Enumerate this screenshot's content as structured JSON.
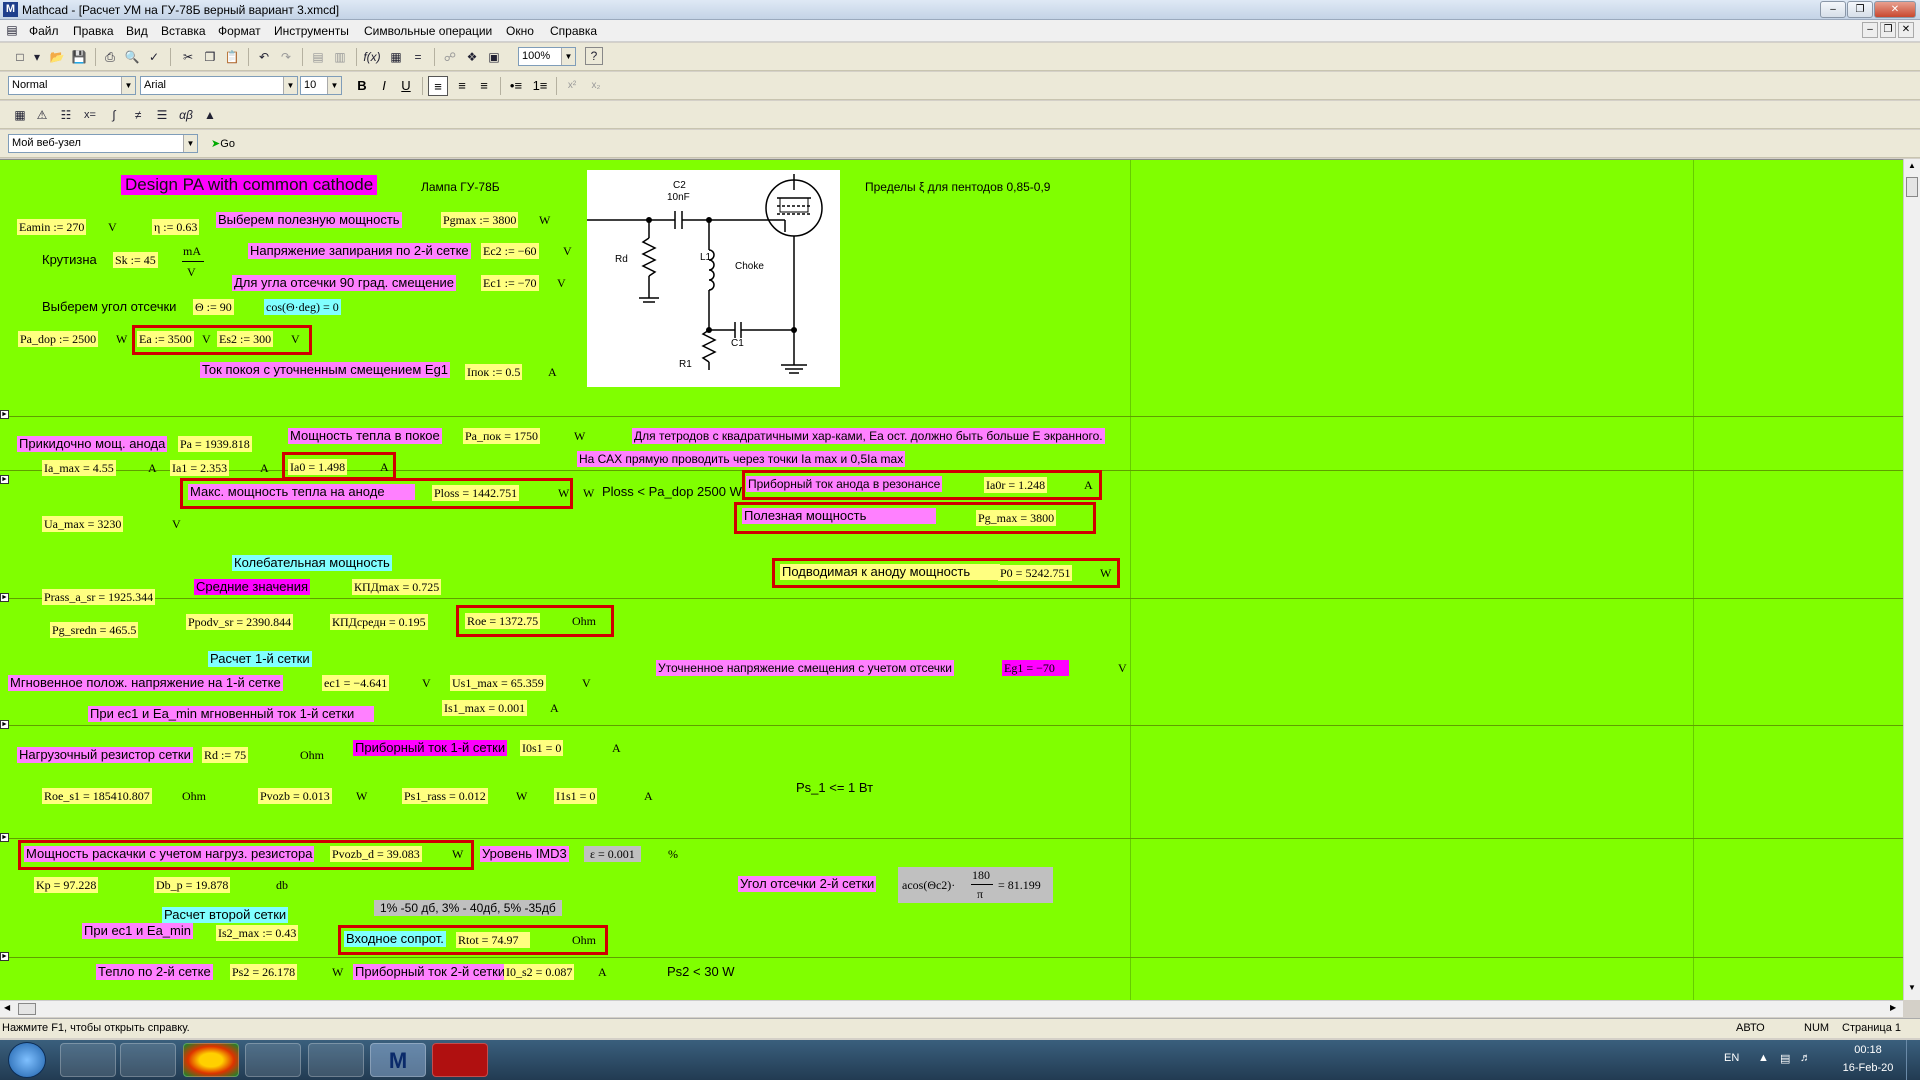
{
  "window": {
    "title": "Mathcad - [Расчет УМ на ГУ-78Б  верный вариант 3.xmcd]",
    "app_icon": "M"
  },
  "menu": [
    "Файл",
    "Правка",
    "Вид",
    "Вставка",
    "Формат",
    "Инструменты",
    "Символьные операции",
    "Окно",
    "Справка"
  ],
  "format_bar": {
    "style": "Normal",
    "font": "Arial",
    "size": "10",
    "bold": "B",
    "italic": "I",
    "underline": "U"
  },
  "toolbar": {
    "zoom": "100%",
    "help": "?"
  },
  "web_bar": {
    "address": "Мой веб-узел",
    "go": "Go"
  },
  "sheet": {
    "title": "Design PA with common cathode",
    "tube": "Лампа ГУ-78Б",
    "xi_limits": "Пределы ξ для пентодов  0,85-0,9",
    "eamin": "Eamin := 270",
    "eamin_u": "V",
    "eta": "η := 0.63",
    "pg_label": "Выберем полезную мощность",
    "pgmax": "Pgmax := 3800",
    "pgmax_u": "W",
    "krutizna": "Крутизна",
    "sk": "Sk := 45",
    "sk_num": "mA",
    "sk_den": "V",
    "ec2_label": "Напряжение запирания по 2-й сетке",
    "ec2": "Ec2 := −60",
    "ec2_u": "V",
    "ec1_label": "Для угла отсечки 90 град. смещение",
    "ec1": "Ec1 := −70",
    "ec1_u": "V",
    "angle_label": "Выберем угол отсечки",
    "theta": "Θ := 90",
    "cos": "cos(Θ·deg) = 0",
    "pa_dop": "Pa_dop := 2500",
    "pa_dop_u": "W",
    "ea": "Ea := 3500",
    "ea_u": "V",
    "es2": "Es2 := 300",
    "es2_u": "V",
    "ipok_label": "Ток покоя с уточненным смещением Eg1",
    "ipok": "Iпок := 0.5",
    "ipok_u": "A",
    "pa_label": "Прикидочно мощ. анода",
    "pa": "Pa = 1939.818",
    "pa_pok_label": "Мощность тепла в покое",
    "pa_pok": "Pa_пок = 1750",
    "pa_pok_u": "W",
    "tetrode_note": "Для тетродов с квадратичными хар-ками, Ea ост. должно быть больше Е экранного.",
    "cax_note": "На САХ прямую проводить через точки Ia max  и 0,5Ia max",
    "ia_max": "Ia_max = 4.55",
    "ia_max_u": "A",
    "ia1": "Ia1 = 2.353",
    "ia1_u": "A",
    "ia0": "Ia0 = 1.498",
    "ia0_u": "A",
    "ia0r_label": "Приборный ток анода  в резонансе",
    "ia0r": "Ia0r = 1.248",
    "ia0r_u": "A",
    "ploss_label": "Макс. мощность тепла на аноде",
    "ploss": "Ploss = 1442.751",
    "ploss_u": "W",
    "ploss_u2": "W",
    "ploss_cmp": "Ploss < Pa_dop 2500 W",
    "ua_max": "Ua_max = 3230",
    "ua_max_u": "V",
    "pg_useful_label": "Полезная мощность",
    "pg_max": "Pg_max = 3800",
    "kolebat": "Колебательная мощность",
    "avg_label": "Средние значения",
    "kpd_max": "КПДmax = 0.725",
    "p0_label": "Подводимая к аноду мощность",
    "p0": "P0 = 5242.751",
    "p0_u": "W",
    "prass": "Prass_a_sr = 1925.344",
    "pg_sredn": "Pg_sredn = 465.5",
    "ppodv": "Ppodv_sr = 2390.844",
    "kpd_sr": "КПДсредн = 0.195",
    "roe": "Roe = 1372.75",
    "roe_u": "Ohm",
    "grid1_title": "Расчет 1-й сетки",
    "eg1_label": "Уточненное напряжение смещения с учетом отсечки",
    "eg1": "Eg1 = −70",
    "eg1_u": "V",
    "ec1_inst_label": "Мгновенное полож. напряжение на 1-й сетке",
    "ec1_inst": "ec1 = −4.641",
    "ec1_inst_u": "V",
    "us1": "Us1_max = 65.359",
    "us1_u": "V",
    "is1_label": "При ec1  и Ea_min мгновенный ток 1-й сетки",
    "is1": "Is1_max = 0.001",
    "is1_u": "A",
    "rd_label": "Нагрузочный резистор сетки",
    "rd": "Rd := 75",
    "rd_u": "Ohm",
    "i0s1_label": "Приборный ток 1-й сетки",
    "i0s1": "I0s1 = 0",
    "i0s1_u": "A",
    "ps1_note": "Ps_1 <= 1 Вт",
    "roe_s1": "Roe_s1 = 185410.807",
    "roe_s1_u": "Ohm",
    "pvozb": "Pvozb = 0.013",
    "pvozb_u": "W",
    "ps1": "Ps1_rass = 0.012",
    "ps1_u": "W",
    "i1s1": "I1s1 = 0",
    "i1s1_u": "A",
    "pvozb_d_label": "Мощность раскачки с учетом нагруз. резистора",
    "pvozb_d": "Pvozb_d = 39.083",
    "pvozb_d_u": "W",
    "imd_label": "Уровень IMD3",
    "eps": "ε = 0.001",
    "eps_u": "%",
    "kp": "Kp = 97.228",
    "db": "Db_p = 19.878",
    "db_u": "db",
    "angle2_label": "Угол отсечки 2-й сетки",
    "acos": "acos(Θc2)·",
    "acos_num": "180",
    "acos_den": "π",
    "acos_val": "= 81.199",
    "imd_note": "1% -50 дб, 3% - 40дб, 5% -35дб",
    "grid2_title": "Расчет второй сетки",
    "is2_label": "При ec1 и Ea_min",
    "is2": "Is2_max := 0.43",
    "rtot_label": "Входное сопрот.",
    "rtot": "Rtot = 74.97",
    "rtot_u": "Ohm",
    "ps2_label": "Тепло по 2-й сетке",
    "ps2": "Ps2 = 26.178",
    "ps2_u": "W",
    "i0s2_label": "Приборный ток 2-й сетки",
    "i0s2": "I0_s2 = 0.087",
    "i0s2_u": "A",
    "ps2_note": "Ps2 < 30 W",
    "schematic": {
      "c2": "C2",
      "c2_val": "10nF",
      "rd": "Rd",
      "l1": "L1",
      "choke": "Choke",
      "r1": "R1",
      "c1": "C1"
    }
  },
  "status": {
    "hint": "Нажмите F1, чтобы открыть справку.",
    "mode": "АВТО",
    "num": "NUM",
    "page": "Страница 1"
  },
  "tray": {
    "lang": "EN",
    "time": "00:18",
    "date": "16-Feb-20"
  },
  "colors": {
    "worksheet": "#80ff00",
    "pink": "#ff80ff",
    "magenta": "#ff00ff",
    "cyan": "#80ffff",
    "yellow": "#ffff80",
    "red_box": "#d00000"
  }
}
